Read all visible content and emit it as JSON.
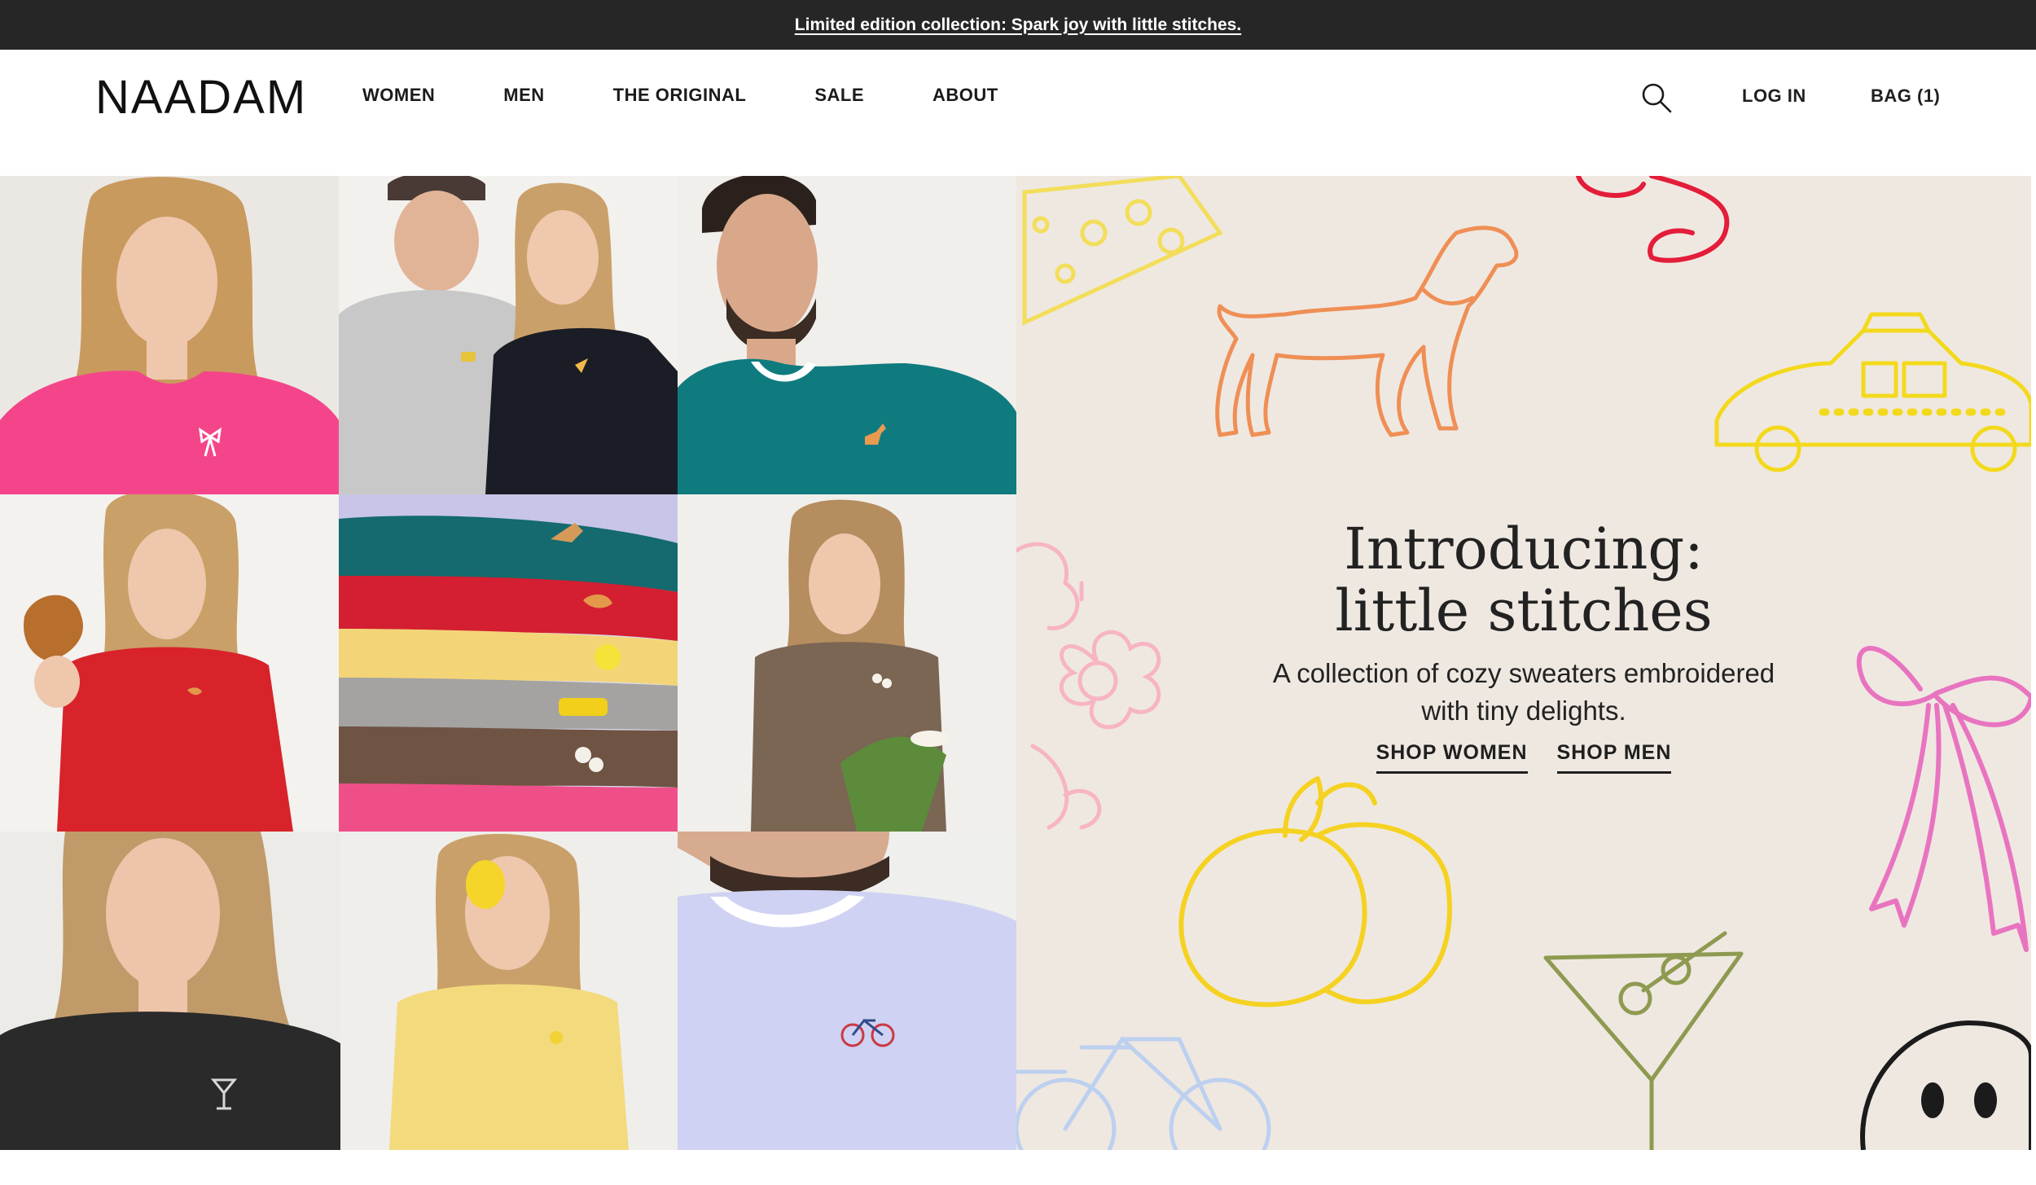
{
  "announcement": {
    "text": "Limited edition collection: Spark joy with little stitches."
  },
  "header": {
    "logo": "NAADAM",
    "nav": [
      "WOMEN",
      "MEN",
      "THE ORIGINAL",
      "SALE",
      "ABOUT"
    ],
    "login": "LOG IN",
    "bag": "BAG (1)",
    "search_icon": "search-icon"
  },
  "hero": {
    "title_line1": "Introducing:",
    "title_line2": "little stitches",
    "subtitle_line1": "A collection of cozy sweaters embroidered",
    "subtitle_line2": "with tiny delights.",
    "cta_women": "SHOP WOMEN",
    "cta_men": "SHOP MEN",
    "background_color": "#efe8e1"
  },
  "grid_tiles": [
    {
      "name": "woman-pink-sweater-bow",
      "colors": {
        "bg": "#e9e7e2",
        "sweater": "#f5458a"
      }
    },
    {
      "name": "couple-grey-black-sweaters",
      "colors": {
        "bg": "#f2f1ed",
        "sweater": "#c9c9c9"
      }
    },
    {
      "name": "man-teal-sweater-dog",
      "colors": {
        "bg": "#f1efeb",
        "sweater": "#0f7b7f"
      }
    },
    {
      "name": "woman-red-sweater-croissant",
      "colors": {
        "bg": "#f3f2ee",
        "sweater": "#d8232b"
      }
    },
    {
      "name": "folded-sweater-stack",
      "colors": {
        "bg": "#d9d8ef",
        "sweater": "#1a6b6f"
      }
    },
    {
      "name": "woman-brown-sweater-flowers",
      "colors": {
        "bg": "#f0efec",
        "sweater": "#7b6553"
      }
    },
    {
      "name": "woman-charcoal-sweater-martini",
      "colors": {
        "bg": "#ecebe7",
        "sweater": "#2a2a2a"
      }
    },
    {
      "name": "woman-yellow-sweater-lemon",
      "colors": {
        "bg": "#efeeea",
        "sweater": "#f3da7d"
      }
    },
    {
      "name": "man-lavender-sweater-bike",
      "colors": {
        "bg": "#efefed",
        "sweater": "#cfd2f2"
      }
    }
  ]
}
